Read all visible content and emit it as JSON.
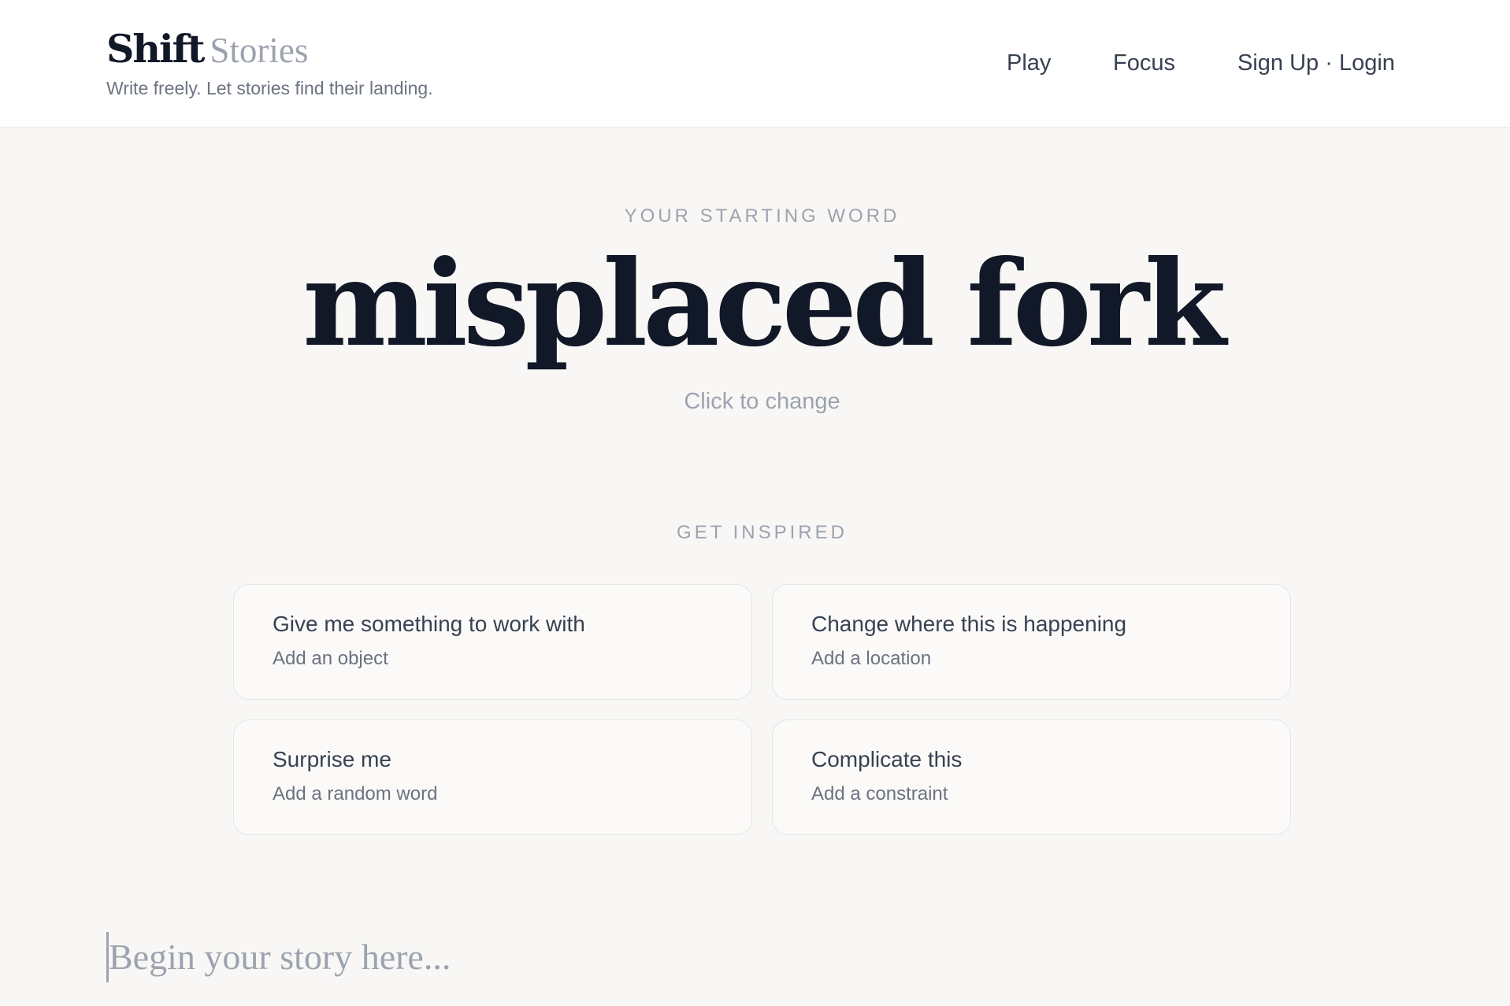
{
  "header": {
    "brand_primary": "Shift",
    "brand_secondary": "Stories",
    "tagline": "Write freely. Let stories find their landing.",
    "nav": {
      "play": "Play",
      "focus": "Focus",
      "auth": "Sign Up · Login"
    }
  },
  "prompt": {
    "eyebrow": "YOUR STARTING WORD",
    "word": "misplaced fork",
    "hint": "Click to change"
  },
  "inspire": {
    "eyebrow": "GET INSPIRED",
    "cards": [
      {
        "title": "Give me something to work with",
        "subtitle": "Add an object"
      },
      {
        "title": "Change where this is happening",
        "subtitle": "Add a location"
      },
      {
        "title": "Surprise me",
        "subtitle": "Add a random word"
      },
      {
        "title": "Complicate this",
        "subtitle": "Add a constraint"
      }
    ]
  },
  "editor": {
    "placeholder": "Begin your story here..."
  }
}
